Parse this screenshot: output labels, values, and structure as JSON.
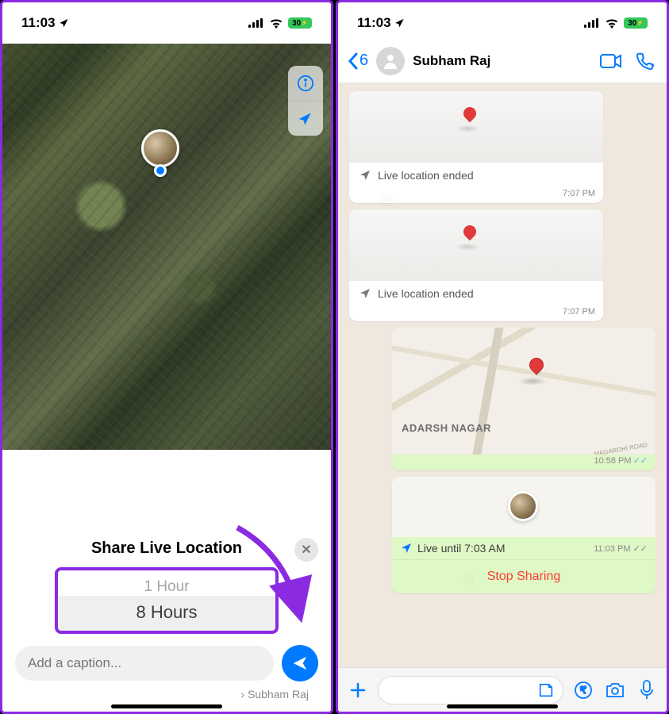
{
  "status": {
    "time": "11:03",
    "battery": "30"
  },
  "left": {
    "sheet_title": "Share Live Location",
    "duration_opt1": "1 Hour",
    "duration_opt2": "8 Hours",
    "caption_placeholder": "Add a caption...",
    "recipient_prefix": "›",
    "recipient": "Subham Raj"
  },
  "right": {
    "back_count": "6",
    "contact": "Subham Raj",
    "msgs": {
      "m1_text": "Live location ended",
      "m1_time": "7:07 PM",
      "m2_text": "Live location ended",
      "m2_time": "7:07 PM",
      "m3_area": "ADARSH NAGAR",
      "m3_road": "MAGARDHI ROAD",
      "m3_time": "10:58 PM",
      "m4_text": "Live until 7:03 AM",
      "m4_time": "11:03 PM",
      "m4_stop": "Stop Sharing"
    }
  }
}
